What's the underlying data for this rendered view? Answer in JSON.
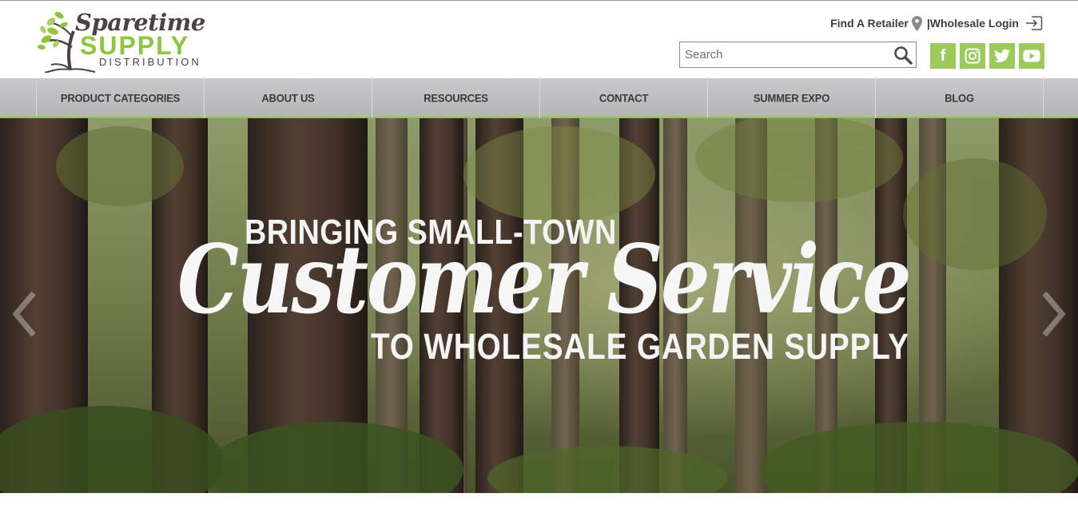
{
  "logo": {
    "line1": "Sparetime",
    "line2": "SUPPLY",
    "line3": "DISTRIBUTION",
    "brand_green": "#8dc63f",
    "brand_dark": "#4a4340"
  },
  "header": {
    "find_retailer": "Find A Retailer",
    "wholesale_login": "|Wholesale Login",
    "search_placeholder": "Search",
    "social": [
      {
        "name": "facebook",
        "glyph": "f"
      },
      {
        "name": "instagram",
        "glyph": ""
      },
      {
        "name": "twitter",
        "glyph": ""
      },
      {
        "name": "youtube",
        "glyph": ""
      }
    ],
    "social_color": "#9ccb5b"
  },
  "nav": {
    "items": [
      {
        "label": "PRODUCT CATEGORIES"
      },
      {
        "label": "ABOUT US"
      },
      {
        "label": "RESOURCES"
      },
      {
        "label": "CONTACT"
      },
      {
        "label": "SUMMER EXPO"
      },
      {
        "label": "BLOG"
      }
    ],
    "accent": "#8dc63f"
  },
  "hero": {
    "line1": "BRINGING SMALL-TOWN",
    "line2": "Customer Service",
    "line3": "TO WHOLESALE GARDEN SUPPLY"
  }
}
